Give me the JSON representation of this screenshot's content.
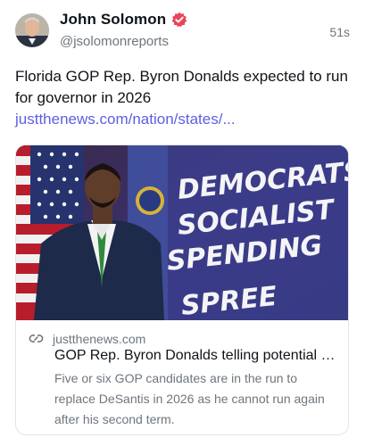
{
  "post": {
    "author_name": "John Solomon",
    "author_handle": "@jsolomonreports",
    "timestamp": "51s",
    "text": "Florida GOP Rep. Byron Donalds expected to run for governor in 2026 ",
    "link_text": "justthenews.com/nation/states/...",
    "verified_icon": "verified-badge-icon"
  },
  "card": {
    "image_sign_text": [
      "DEMOCRATS'",
      "SOCIALIST",
      "SPENDING",
      "SPREE"
    ],
    "domain": "justthenews.com",
    "title": "GOP Rep. Byron Donalds telling potential donors he's running for Florida governor",
    "description": "Five or six GOP candidates are in the run to replace DeSantis in 2026 as he cannot run again after his second term."
  },
  "colors": {
    "link": "#5b5fe0",
    "verified": "#e8475a",
    "muted": "#6e767d"
  }
}
